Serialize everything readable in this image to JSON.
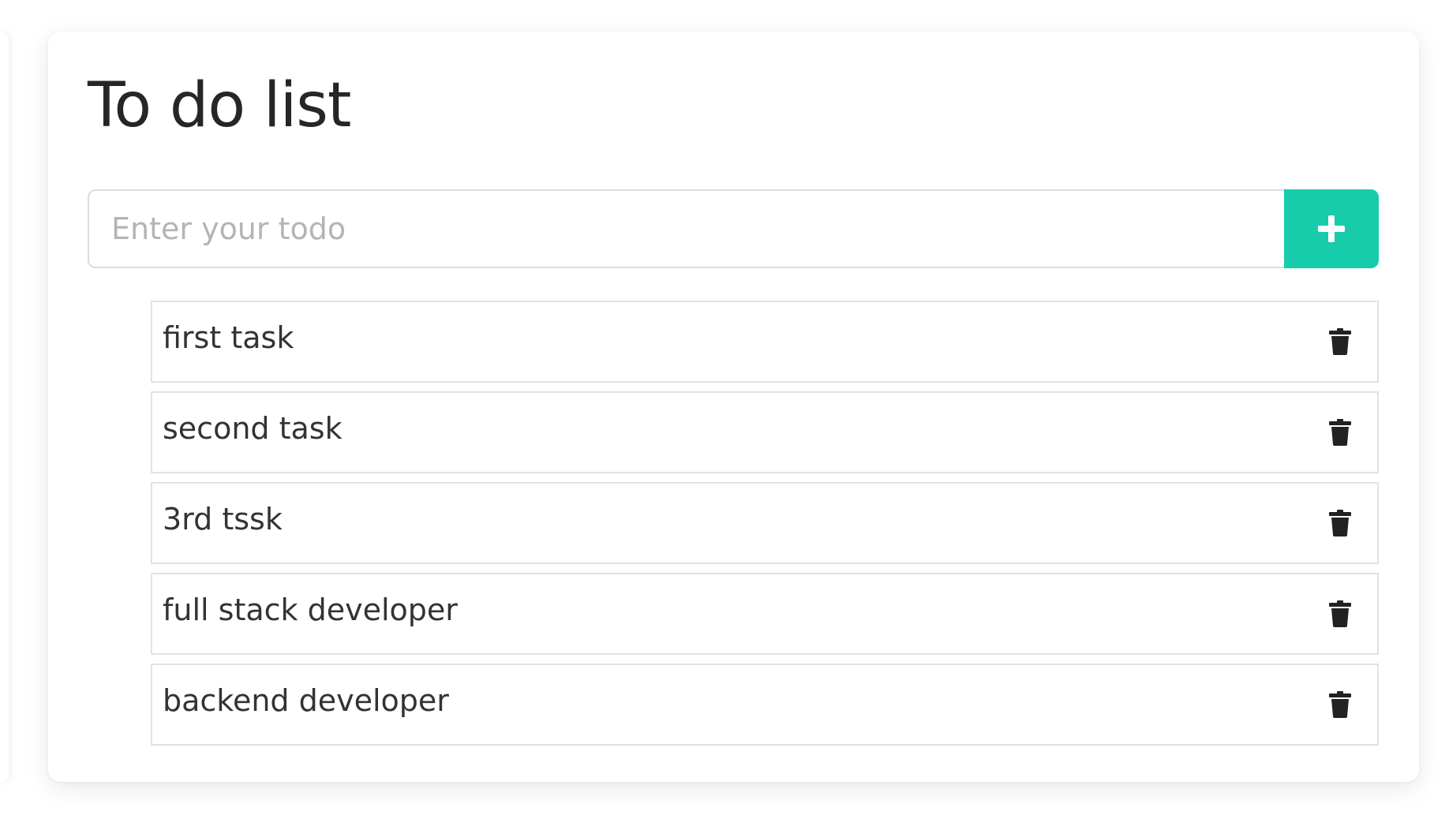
{
  "app": {
    "title": "To do list"
  },
  "input": {
    "placeholder": "Enter your todo",
    "value": ""
  },
  "add_button": {
    "icon": "plus-icon",
    "color": "#17ccaa"
  },
  "todos": [
    {
      "text": "first task",
      "icon": "trash-icon"
    },
    {
      "text": "second task",
      "icon": "trash-icon"
    },
    {
      "text": "3rd tssk",
      "icon": "trash-icon"
    },
    {
      "text": "full stack developer",
      "icon": "trash-icon"
    },
    {
      "text": "backend developer",
      "icon": "trash-icon"
    }
  ]
}
